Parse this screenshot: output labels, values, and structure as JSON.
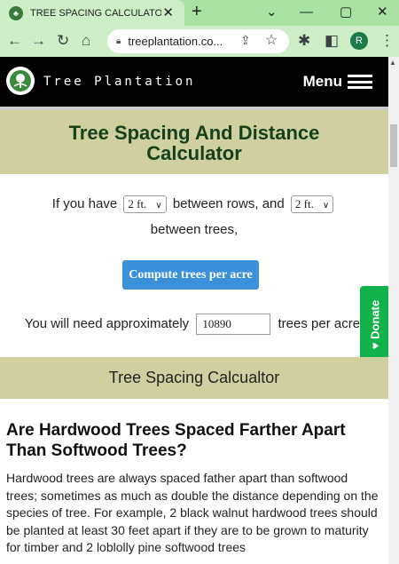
{
  "browser": {
    "tab_title": "TREE SPACING CALCULATOR |",
    "tab_close": "✕",
    "new_tab": "+",
    "window_controls": [
      "⌄",
      "—",
      "▢",
      "✕"
    ],
    "url": "treeplantation.co...",
    "profile_initial": "R"
  },
  "site": {
    "brand": "Tree Plantation",
    "menu_label": "Menu"
  },
  "hero": {
    "title_line1": "Tree Spacing And Distance",
    "title_line2": "Calculator"
  },
  "calculator": {
    "intro": "If you have",
    "row_spacing": "2 ft.",
    "between_rows": "between rows, and",
    "tree_spacing": "2 ft.",
    "between_trees": "between trees,",
    "compute_button": "Compute trees per acre",
    "need_text": "You will need approximately",
    "result": "10890",
    "per_acre": "trees per acre."
  },
  "donate": {
    "label": "Donate"
  },
  "section_band": {
    "title": "Tree Spacing Calcualtor"
  },
  "article": {
    "heading": "Are Hardwood Trees Spaced Farther Apart Than Softwood Trees?",
    "body": "Hardwood trees are always spaced father apart than softwood trees; sometimes as much as double the distance depending on the species of tree. For example, 2 black walnut hardwood trees should be planted at least 30 feet apart if they are to be grown to maturity for timber and 2 loblolly pine softwood trees"
  },
  "colors": {
    "tab_strip": "#a8e2a0",
    "toolbar": "#cdeec7",
    "header_bg": "#000000",
    "hero_bg": "#cfcf9f",
    "hero_text": "#14401a",
    "button": "#3a91d9",
    "donate": "#12b24a"
  }
}
